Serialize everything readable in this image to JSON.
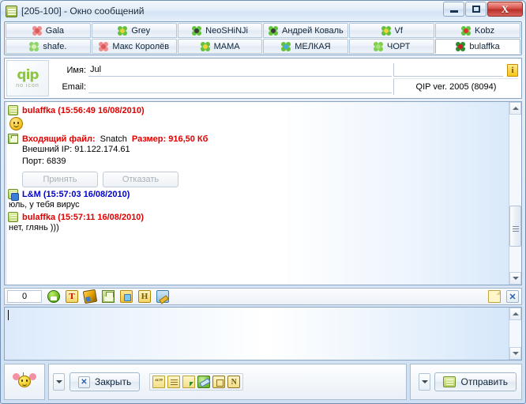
{
  "window": {
    "title": "[205-100] - Окно сообщений",
    "title_icon": "contact-card-icon",
    "minimize_label": "",
    "maximize_label": "",
    "close_label": "X"
  },
  "tabs": {
    "row1": [
      {
        "label": "Gala",
        "icon": "flower-pink-icon",
        "c1": "#f08b8b",
        "c2": "#d85a5a",
        "active": false
      },
      {
        "label": "Grey",
        "icon": "clover-green-icon",
        "c1": "#63c23c",
        "c2": "#e8d23a",
        "active": false
      },
      {
        "label": "NeoSHiNJi",
        "icon": "clover-sunglasses-icon",
        "c1": "#63c23c",
        "c2": "#3b3b3b",
        "active": false
      },
      {
        "label": "Андрей Коваль",
        "icon": "clover-sunglasses-icon",
        "c1": "#63c23c",
        "c2": "#3b3b3b",
        "active": false
      },
      {
        "label": "Vf",
        "icon": "clover-yellow-icon",
        "c1": "#63c23c",
        "c2": "#f0d23a",
        "active": false
      },
      {
        "label": "Kobz",
        "icon": "flower-red-icon",
        "c1": "#63c23c",
        "c2": "#e03030",
        "active": false
      }
    ],
    "row2": [
      {
        "label": "shafe.",
        "icon": "leaf-green-icon",
        "c1": "#8fd46a",
        "c2": "#d8f0b8",
        "active": false
      },
      {
        "label": "Макс Королёв",
        "icon": "flower-pink-icon",
        "c1": "#f08b8b",
        "c2": "#d85a5a",
        "active": false
      },
      {
        "label": "МАМА",
        "icon": "clover-yellow-icon",
        "c1": "#63c23c",
        "c2": "#f0d23a",
        "active": false
      },
      {
        "label": "МЕЛКАЯ",
        "icon": "clover-blue-icon",
        "c1": "#63c23c",
        "c2": "#4aa8e0",
        "active": false
      },
      {
        "label": "ЧОРТ",
        "icon": "clover-green-icon",
        "c1": "#7ed04a",
        "c2": "#a8e07a",
        "active": false
      },
      {
        "label": "bulaffka",
        "icon": "ladybug-red-icon",
        "c1": "#2e8b2e",
        "c2": "#d02020",
        "active": true
      }
    ]
  },
  "info_panel": {
    "logo_word": "qip",
    "logo_sub": "no icon",
    "name_label": "Имя:",
    "name_value": "Jul",
    "email_label": "Email:",
    "email_value": "",
    "status_value": "",
    "version": "QIP ver. 2005 (8094)",
    "info_icon": "info-icon"
  },
  "messages": [
    {
      "type": "text",
      "icon": "contact-card-icon",
      "nick": "bulaffka (15:56:49 16/08/2010)",
      "direction": "out",
      "body": "",
      "has_smiley": true
    },
    {
      "type": "file_transfer",
      "icon": "floppy-disk-icon",
      "file_label": "Входящий файл:",
      "file_name": "Snatch",
      "size_label": "Размер: 916,50 Кб",
      "ip_line": "Внешний IP: 91.122.174.61",
      "port_line": "Порт: 6839",
      "accept_label": "Принять",
      "decline_label": "Отказать"
    },
    {
      "type": "text",
      "icon": "contact-card-check-icon",
      "nick": "L&M (15:57:03 16/08/2010)",
      "direction": "in",
      "body": "юль, у тебя вирус",
      "has_smiley": false
    },
    {
      "type": "text",
      "icon": "contact-card-icon",
      "nick": "bulaffka (15:57:11 16/08/2010)",
      "direction": "out",
      "body": "нет, глянь )))",
      "has_smiley": false
    }
  ],
  "edit_toolbar": {
    "char_counter": "0",
    "icons": [
      {
        "name": "smiley-icon",
        "cls": "ico-grin",
        "glyph": ""
      },
      {
        "name": "text-format-icon",
        "cls": "ico-T",
        "glyph": "T"
      },
      {
        "name": "paint-brush-icon",
        "cls": "ico-brush",
        "glyph": ""
      },
      {
        "name": "save-icon",
        "cls": "ico-save",
        "glyph": ""
      },
      {
        "name": "folder-icon",
        "cls": "ico-folder",
        "glyph": ""
      },
      {
        "name": "history-icon",
        "cls": "ico-H",
        "glyph": "H"
      },
      {
        "name": "preferences-icon",
        "cls": "ico-prefs",
        "glyph": ""
      }
    ],
    "right_icons": [
      {
        "name": "new-page-icon",
        "cls": "ico-page",
        "glyph": ""
      },
      {
        "name": "clear-close-icon",
        "cls": "ico-closex",
        "glyph": "✕"
      }
    ]
  },
  "input": {
    "value": "",
    "placeholder": ""
  },
  "bottom_bar": {
    "avatar_icon": "bee-avatar-icon",
    "close_dropdown_arrow": "chevron-down-icon",
    "close_button_label": "Закрыть",
    "close_button_icon": "close-x-icon",
    "tool_icons": [
      {
        "name": "quote-icon",
        "cls": "sm-quote",
        "glyph": "“”"
      },
      {
        "name": "text-lines-icon",
        "cls": "sm-list",
        "glyph": ""
      },
      {
        "name": "contact-select-icon",
        "cls": "sm-contact",
        "glyph": ""
      },
      {
        "name": "tools-wrench-icon",
        "cls": "sm-tool",
        "glyph": ""
      },
      {
        "name": "window-restore-icon",
        "cls": "sm-win",
        "glyph": ""
      },
      {
        "name": "notes-n-icon",
        "cls": "sm-n",
        "glyph": "N"
      }
    ],
    "send_dropdown_arrow": "chevron-down-icon",
    "send_button_label": "Отправить",
    "send_button_icon": "send-card-icon"
  },
  "scrollbars": {
    "log_up": "scroll-up-arrow",
    "log_down": "scroll-down-arrow",
    "input_up": "scroll-up-arrow",
    "input_down": "scroll-down-arrow"
  },
  "colors": {
    "outgoing_nick": "#e00000",
    "incoming_nick": "#0000cc",
    "file_highlight": "#e00000",
    "accent": "#8cc63f"
  }
}
